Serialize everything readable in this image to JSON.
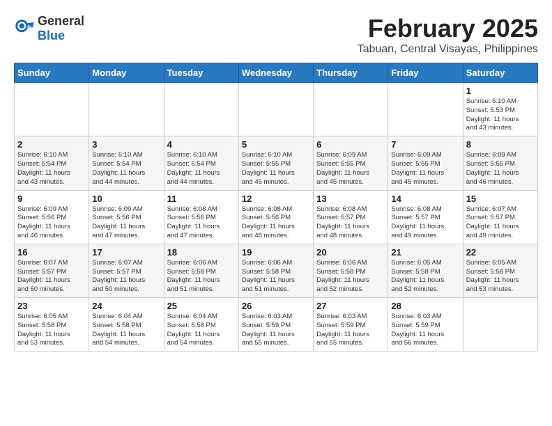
{
  "header": {
    "logo_general": "General",
    "logo_blue": "Blue",
    "main_title": "February 2025",
    "subtitle": "Tabuan, Central Visayas, Philippines"
  },
  "calendar": {
    "weekdays": [
      "Sunday",
      "Monday",
      "Tuesday",
      "Wednesday",
      "Thursday",
      "Friday",
      "Saturday"
    ],
    "weeks": [
      [
        {
          "day": "",
          "info": ""
        },
        {
          "day": "",
          "info": ""
        },
        {
          "day": "",
          "info": ""
        },
        {
          "day": "",
          "info": ""
        },
        {
          "day": "",
          "info": ""
        },
        {
          "day": "",
          "info": ""
        },
        {
          "day": "1",
          "info": "Sunrise: 6:10 AM\nSunset: 5:53 PM\nDaylight: 11 hours\nand 43 minutes."
        }
      ],
      [
        {
          "day": "2",
          "info": "Sunrise: 6:10 AM\nSunset: 5:54 PM\nDaylight: 11 hours\nand 43 minutes."
        },
        {
          "day": "3",
          "info": "Sunrise: 6:10 AM\nSunset: 5:54 PM\nDaylight: 11 hours\nand 44 minutes."
        },
        {
          "day": "4",
          "info": "Sunrise: 6:10 AM\nSunset: 5:54 PM\nDaylight: 11 hours\nand 44 minutes."
        },
        {
          "day": "5",
          "info": "Sunrise: 6:10 AM\nSunset: 5:55 PM\nDaylight: 11 hours\nand 45 minutes."
        },
        {
          "day": "6",
          "info": "Sunrise: 6:09 AM\nSunset: 5:55 PM\nDaylight: 11 hours\nand 45 minutes."
        },
        {
          "day": "7",
          "info": "Sunrise: 6:09 AM\nSunset: 5:55 PM\nDaylight: 11 hours\nand 45 minutes."
        },
        {
          "day": "8",
          "info": "Sunrise: 6:09 AM\nSunset: 5:55 PM\nDaylight: 11 hours\nand 46 minutes."
        }
      ],
      [
        {
          "day": "9",
          "info": "Sunrise: 6:09 AM\nSunset: 5:56 PM\nDaylight: 11 hours\nand 46 minutes."
        },
        {
          "day": "10",
          "info": "Sunrise: 6:09 AM\nSunset: 5:56 PM\nDaylight: 11 hours\nand 47 minutes."
        },
        {
          "day": "11",
          "info": "Sunrise: 6:08 AM\nSunset: 5:56 PM\nDaylight: 11 hours\nand 47 minutes."
        },
        {
          "day": "12",
          "info": "Sunrise: 6:08 AM\nSunset: 5:56 PM\nDaylight: 11 hours\nand 48 minutes."
        },
        {
          "day": "13",
          "info": "Sunrise: 6:08 AM\nSunset: 5:57 PM\nDaylight: 11 hours\nand 48 minutes."
        },
        {
          "day": "14",
          "info": "Sunrise: 6:08 AM\nSunset: 5:57 PM\nDaylight: 11 hours\nand 49 minutes."
        },
        {
          "day": "15",
          "info": "Sunrise: 6:07 AM\nSunset: 5:57 PM\nDaylight: 11 hours\nand 49 minutes."
        }
      ],
      [
        {
          "day": "16",
          "info": "Sunrise: 6:07 AM\nSunset: 5:57 PM\nDaylight: 11 hours\nand 50 minutes."
        },
        {
          "day": "17",
          "info": "Sunrise: 6:07 AM\nSunset: 5:57 PM\nDaylight: 11 hours\nand 50 minutes."
        },
        {
          "day": "18",
          "info": "Sunrise: 6:06 AM\nSunset: 5:58 PM\nDaylight: 11 hours\nand 51 minutes."
        },
        {
          "day": "19",
          "info": "Sunrise: 6:06 AM\nSunset: 5:58 PM\nDaylight: 11 hours\nand 51 minutes."
        },
        {
          "day": "20",
          "info": "Sunrise: 6:06 AM\nSunset: 5:58 PM\nDaylight: 11 hours\nand 52 minutes."
        },
        {
          "day": "21",
          "info": "Sunrise: 6:05 AM\nSunset: 5:58 PM\nDaylight: 11 hours\nand 52 minutes."
        },
        {
          "day": "22",
          "info": "Sunrise: 6:05 AM\nSunset: 5:58 PM\nDaylight: 11 hours\nand 53 minutes."
        }
      ],
      [
        {
          "day": "23",
          "info": "Sunrise: 6:05 AM\nSunset: 5:58 PM\nDaylight: 11 hours\nand 53 minutes."
        },
        {
          "day": "24",
          "info": "Sunrise: 6:04 AM\nSunset: 5:58 PM\nDaylight: 11 hours\nand 54 minutes."
        },
        {
          "day": "25",
          "info": "Sunrise: 6:04 AM\nSunset: 5:58 PM\nDaylight: 11 hours\nand 54 minutes."
        },
        {
          "day": "26",
          "info": "Sunrise: 6:03 AM\nSunset: 5:59 PM\nDaylight: 11 hours\nand 55 minutes."
        },
        {
          "day": "27",
          "info": "Sunrise: 6:03 AM\nSunset: 5:59 PM\nDaylight: 11 hours\nand 55 minutes."
        },
        {
          "day": "28",
          "info": "Sunrise: 6:03 AM\nSunset: 5:59 PM\nDaylight: 11 hours\nand 56 minutes."
        },
        {
          "day": "",
          "info": ""
        }
      ]
    ]
  }
}
